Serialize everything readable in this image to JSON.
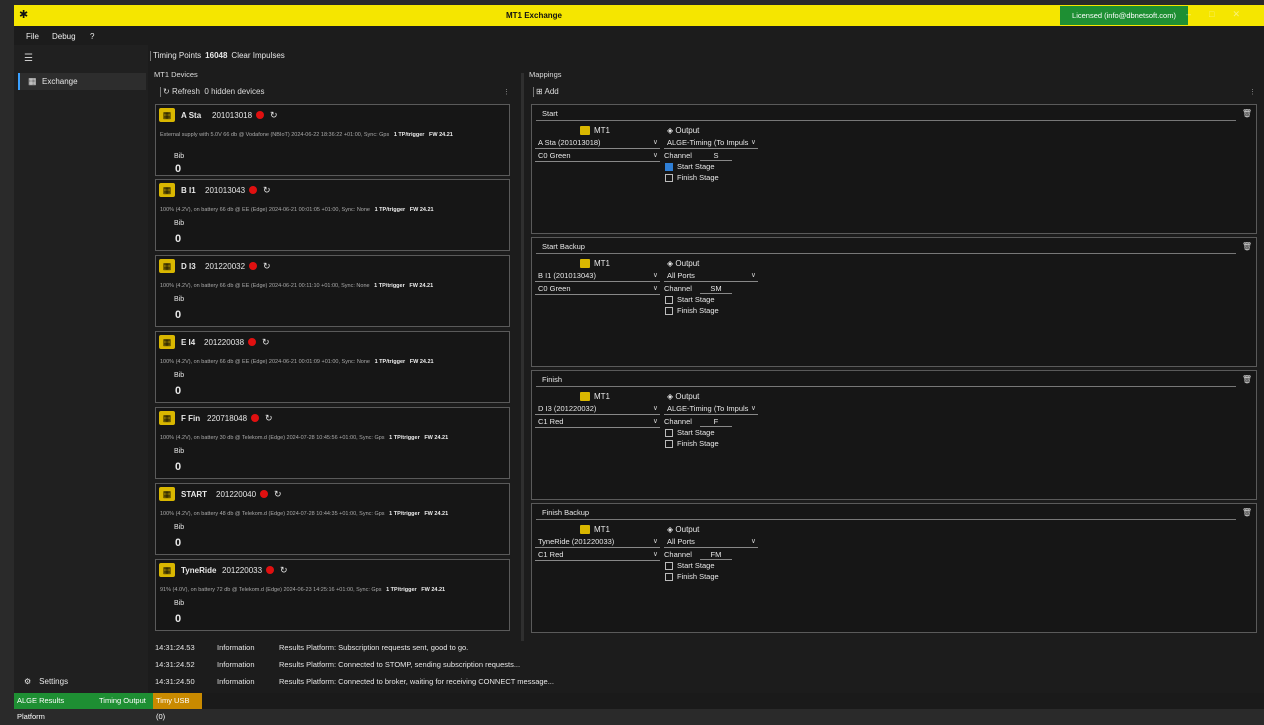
{
  "window": {
    "title": "MT1 Exchange",
    "license": "Licensed (info@dbnetsoft.com)"
  },
  "menu": [
    "File",
    "Debug",
    "?"
  ],
  "sidebar": {
    "items": [
      {
        "label": "Exchange",
        "icon": "network-icon"
      }
    ],
    "settings_label": "Settings"
  },
  "toolbar": {
    "timing_points_label": "Timing Points",
    "timing_points_value": "16048",
    "clear_label": "Clear Impulses"
  },
  "devices_panel": {
    "title": "MT1 Devices",
    "refresh_label": "Refresh",
    "hidden_label": "0 hidden devices",
    "bib_label": "Bib",
    "devices": [
      {
        "name": "A Sta",
        "serial": "201013018",
        "info": "External supply with 5.0V   66 db @ Vodafone (NBIoT)   2024-06-22 18:36:22 +01:00, Sync: Gps",
        "trigger": "1 TP/trigger",
        "fw": "FW 24.21",
        "bib": "0"
      },
      {
        "name": "B I1",
        "serial": "201013043",
        "info": "100% (4.2V), on battery   66 db @ EE (Edge)   2024-06-21 00:01:05 +01:00, Sync: None",
        "trigger": "1 TP/trigger",
        "fw": "FW 24.21",
        "bib": "0"
      },
      {
        "name": "D I3",
        "serial": "201220032",
        "info": "100% (4.2V), on battery   66 db @ EE (Edge)   2024-06-21 00:11:10 +01:00, Sync: None",
        "trigger": "1 TP/trigger",
        "fw": "FW 24.21",
        "bib": "0"
      },
      {
        "name": "E I4",
        "serial": "201220038",
        "info": "100% (4.2V), on battery   66 db @ EE (Edge)   2024-06-21 00:01:09 +01:00, Sync: None",
        "trigger": "1 TP/trigger",
        "fw": "FW 24.21",
        "bib": "0"
      },
      {
        "name": "F Fin",
        "serial": "220718048",
        "info": "100% (4.2V), on battery   30 db @ Telekom.d (Edge)   2024-07-28 10:45:56 +01:00, Sync: Gps",
        "trigger": "1 TP/trigger",
        "fw": "FW 24.21",
        "bib": "0"
      },
      {
        "name": "START",
        "serial": "201220040",
        "info": "100% (4.2V), on battery   48 db @ Telekom.d (Edge)   2024-07-28 10:44:35 +01:00, Sync: Gps",
        "trigger": "1 TP/trigger",
        "fw": "FW 24.21",
        "bib": "0"
      },
      {
        "name": "TyneRide",
        "serial": "201220033",
        "info": "91% (4.0V), on battery   72 db @ Telekom.d (Edge)   2024-06-23 14:25:16 +01:00, Sync: Gps",
        "trigger": "1 TP/trigger",
        "fw": "FW 24.21",
        "bib": "0"
      }
    ]
  },
  "mappings_panel": {
    "title": "Mappings",
    "add_label": "Add",
    "mt1_header": "MT1",
    "output_header": "Output",
    "channel_label": "Channel",
    "start_stage_label": "Start Stage",
    "finish_stage_label": "Finish Stage",
    "mappings": [
      {
        "name": "Start",
        "device": "A  Sta (201013018)",
        "channel_select": "C0 Green",
        "output": "ALGE-Timing (To Impuls",
        "channel": "S",
        "start_stage": true,
        "finish_stage": false
      },
      {
        "name": "Start Backup",
        "device": "B  I1 (201013043)",
        "channel_select": "C0 Green",
        "output": "All Ports",
        "channel": "SM",
        "start_stage": false,
        "finish_stage": false
      },
      {
        "name": "Finish",
        "device": "D  I3 (201220032)",
        "channel_select": "C1 Red",
        "output": "ALGE-Timing (To Impuls",
        "channel": "F",
        "start_stage": false,
        "finish_stage": false
      },
      {
        "name": "Finish Backup",
        "device": "TyneRide (201220033)",
        "channel_select": "C1 Red",
        "output": "All Ports",
        "channel": "FM",
        "start_stage": false,
        "finish_stage": false
      }
    ]
  },
  "log": [
    {
      "time": "14:31:24.53",
      "level": "Information",
      "message": "Results Platform: Subscription requests sent, good to go."
    },
    {
      "time": "14:31:24.52",
      "level": "Information",
      "message": "Results Platform: Connected to STOMP, sending subscription requests..."
    },
    {
      "time": "14:31:24.50",
      "level": "Information",
      "message": "Results Platform: Connected to broker, waiting for receiving CONNECT message..."
    }
  ],
  "statusbar": [
    {
      "label": "ALGE Results Platform",
      "color": "#1e8f33"
    },
    {
      "label": "Timing Output",
      "color": "#1e8f33"
    },
    {
      "label": "Timy USB (0)",
      "color": "#c98a00"
    }
  ],
  "colors": {
    "titlebar": "#f5e600",
    "license": "#1e8f33",
    "device_status": "#e01010",
    "selected_accent": "#3aa0ff"
  }
}
